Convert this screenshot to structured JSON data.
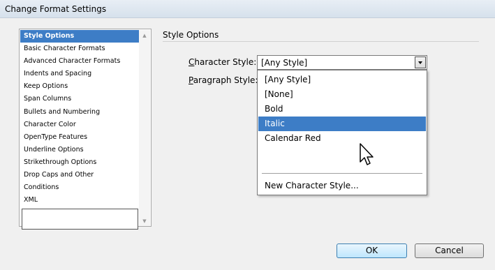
{
  "window": {
    "title": "Change Format Settings"
  },
  "sidebar": {
    "items": [
      {
        "label": "Style Options",
        "selected": true
      },
      {
        "label": "Basic Character Formats",
        "selected": false
      },
      {
        "label": "Advanced Character Formats",
        "selected": false
      },
      {
        "label": "Indents and Spacing",
        "selected": false
      },
      {
        "label": "Keep Options",
        "selected": false
      },
      {
        "label": "Span Columns",
        "selected": false
      },
      {
        "label": "Bullets and Numbering",
        "selected": false
      },
      {
        "label": "Character Color",
        "selected": false
      },
      {
        "label": "OpenType Features",
        "selected": false
      },
      {
        "label": "Underline Options",
        "selected": false
      },
      {
        "label": "Strikethrough Options",
        "selected": false
      },
      {
        "label": "Drop Caps and Other",
        "selected": false
      },
      {
        "label": "Conditions",
        "selected": false
      },
      {
        "label": "XML",
        "selected": false
      }
    ],
    "scroll_up_icon": "triangle-up-icon",
    "scroll_down_icon": "triangle-down-icon"
  },
  "panel": {
    "heading": "Style Options",
    "character_style": {
      "label_accel": "C",
      "label_rest": "haracter Style:",
      "value": "[Any Style]",
      "options": [
        "[Any Style]",
        "[None]",
        "Bold",
        "Italic",
        "Calendar Red"
      ],
      "highlighted": "Italic",
      "new_style_label": "New Character Style..."
    },
    "paragraph_style": {
      "label_accel": "P",
      "label_rest": "aragraph Style:"
    }
  },
  "buttons": {
    "ok": "OK",
    "cancel": "Cancel"
  },
  "colors": {
    "selection": "#3d7dc6",
    "ok_border": "#3c7fb1"
  },
  "cursor_icon": "arrow-cursor-icon"
}
